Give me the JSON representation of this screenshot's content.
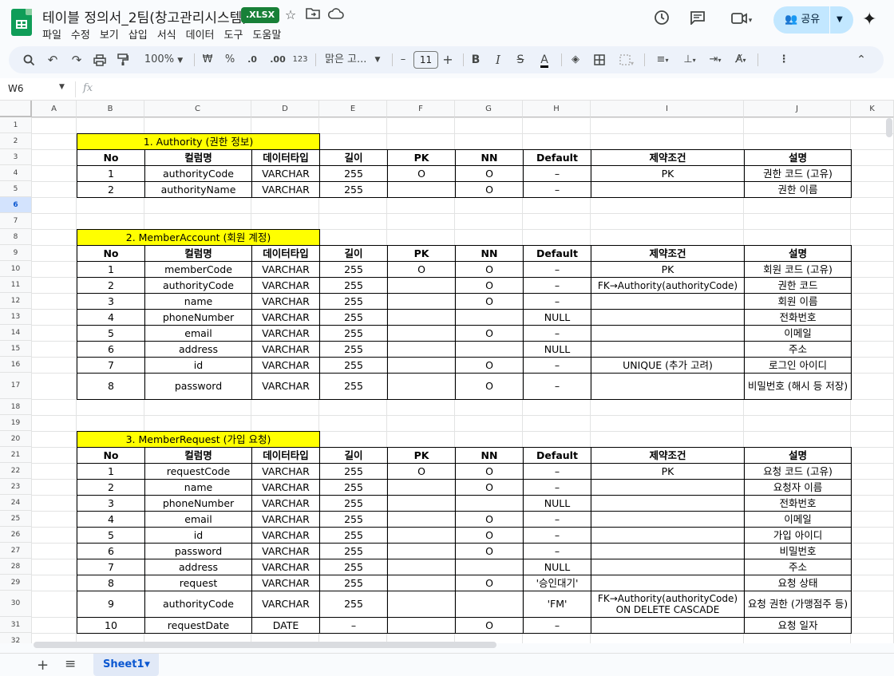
{
  "app": {
    "doc_title": "테이블 정의서_2팀(창고관리시스템)",
    "file_badge": ".XLSX",
    "menus": [
      "파일",
      "수정",
      "보기",
      "삽입",
      "서식",
      "데이터",
      "도구",
      "도움말"
    ],
    "share_label": "공유",
    "colors": {
      "accent": "#0b57d0",
      "sheets_green": "#0f9d58",
      "share_bg": "#c2e7ff",
      "highlight": "#ffff00"
    }
  },
  "toolbar": {
    "zoom": "100%",
    "currency": "₩",
    "percent": "%",
    "dec_decrease": ".0",
    "dec_increase": ".00",
    "number_format": "123",
    "font_name": "맑은 고...",
    "font_size": "11",
    "minus": "–",
    "plus": "+"
  },
  "formula": {
    "cell_ref": "W6",
    "fx": "fx",
    "value": ""
  },
  "columns": [
    "A",
    "B",
    "C",
    "D",
    "E",
    "F",
    "G",
    "H",
    "I",
    "J",
    "K"
  ],
  "rows": [
    "1",
    "2",
    "3",
    "4",
    "5",
    "6",
    "7",
    "8",
    "9",
    "10",
    "11",
    "12",
    "13",
    "14",
    "15",
    "16",
    "17",
    "18",
    "19",
    "20",
    "21",
    "22",
    "23",
    "24",
    "25",
    "26",
    "27",
    "28",
    "29",
    "30",
    "31",
    "32"
  ],
  "selected_row": "6",
  "header_row": [
    "No",
    "컬럼명",
    "데이터타입",
    "길이",
    "PK",
    "NN",
    "Default",
    "제약조건",
    "설명"
  ],
  "tables": [
    {
      "title": "1. Authority (권한 정보)",
      "rows": [
        [
          "1",
          "authorityCode",
          "VARCHAR",
          "255",
          "O",
          "O",
          "–",
          "PK",
          "권한 코드 (고유)"
        ],
        [
          "2",
          "authorityName",
          "VARCHAR",
          "255",
          "",
          "O",
          "–",
          "",
          "권한 이름"
        ]
      ]
    },
    {
      "title": "2. MemberAccount (회원 계정)",
      "rows": [
        [
          "1",
          "memberCode",
          "VARCHAR",
          "255",
          "O",
          "O",
          "–",
          "PK",
          "회원 코드 (고유)"
        ],
        [
          "2",
          "authorityCode",
          "VARCHAR",
          "255",
          "",
          "O",
          "–",
          "FK→Authority(authorityCode)",
          "권한 코드"
        ],
        [
          "3",
          "name",
          "VARCHAR",
          "255",
          "",
          "O",
          "–",
          "",
          "회원 이름"
        ],
        [
          "4",
          "phoneNumber",
          "VARCHAR",
          "255",
          "",
          "",
          "NULL",
          "",
          "전화번호"
        ],
        [
          "5",
          "email",
          "VARCHAR",
          "255",
          "",
          "O",
          "–",
          "",
          "이메일"
        ],
        [
          "6",
          "address",
          "VARCHAR",
          "255",
          "",
          "",
          "NULL",
          "",
          "주소"
        ],
        [
          "7",
          "id",
          "VARCHAR",
          "255",
          "",
          "O",
          "–",
          "UNIQUE (추가 고려)",
          "로그인 아이디"
        ],
        [
          "8",
          "password",
          "VARCHAR",
          "255",
          "",
          "O",
          "–",
          "",
          "비밀번호 (해시 등 저장)"
        ]
      ]
    },
    {
      "title": "3. MemberRequest (가입 요청)",
      "rows": [
        [
          "1",
          "requestCode",
          "VARCHAR",
          "255",
          "O",
          "O",
          "–",
          "PK",
          "요청 코드 (고유)"
        ],
        [
          "2",
          "name",
          "VARCHAR",
          "255",
          "",
          "O",
          "–",
          "",
          "요청자 이름"
        ],
        [
          "3",
          "phoneNumber",
          "VARCHAR",
          "255",
          "",
          "",
          "NULL",
          "",
          "전화번호"
        ],
        [
          "4",
          "email",
          "VARCHAR",
          "255",
          "",
          "O",
          "–",
          "",
          "이메일"
        ],
        [
          "5",
          "id",
          "VARCHAR",
          "255",
          "",
          "O",
          "–",
          "",
          "가입 아이디"
        ],
        [
          "6",
          "password",
          "VARCHAR",
          "255",
          "",
          "O",
          "–",
          "",
          "비밀번호"
        ],
        [
          "7",
          "address",
          "VARCHAR",
          "255",
          "",
          "",
          "NULL",
          "",
          "주소"
        ],
        [
          "8",
          "request",
          "VARCHAR",
          "255",
          "",
          "O",
          "'승인대기'",
          "",
          "요청 상태"
        ],
        [
          "9",
          "authorityCode",
          "VARCHAR",
          "255",
          "",
          "",
          "'FM'",
          "FK→Authority(authorityCode) ON DELETE CASCADE",
          "요청 권한 (가맹점주 등)"
        ],
        [
          "10",
          "requestDate",
          "DATE",
          "–",
          "",
          "O",
          "–",
          "",
          "요청 일자"
        ]
      ]
    }
  ],
  "sheet_tab": "Sheet1"
}
